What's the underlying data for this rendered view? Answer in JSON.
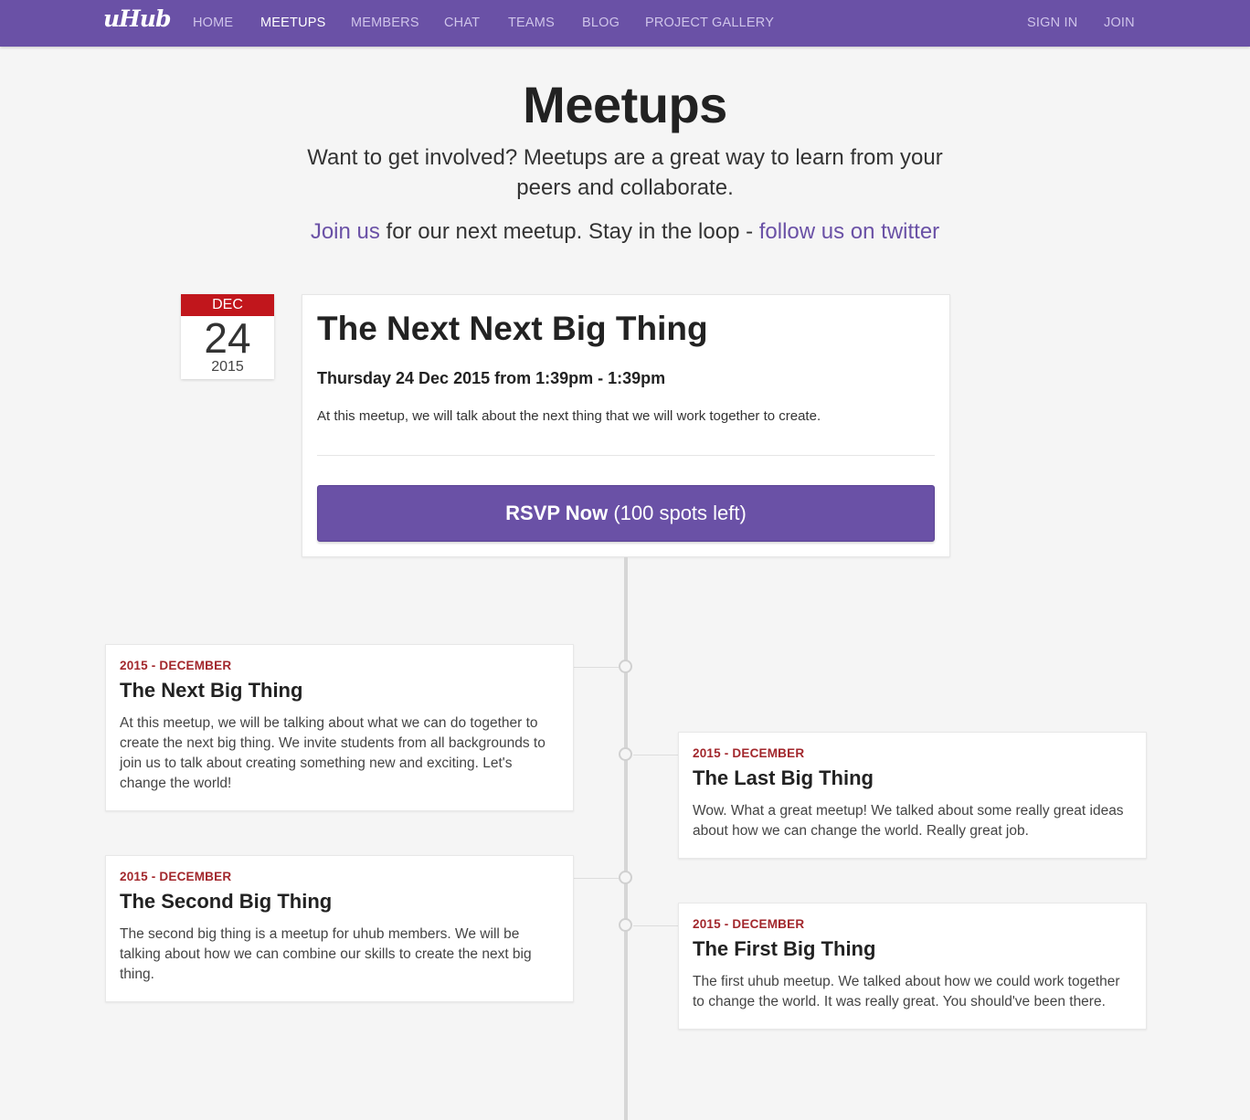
{
  "nav": {
    "brand": "uHub",
    "links": [
      "HOME",
      "MEETUPS",
      "MEMBERS",
      "CHAT",
      "TEAMS",
      "BLOG",
      "PROJECT GALLERY"
    ],
    "right": [
      "SIGN IN",
      "JOIN"
    ],
    "active": "MEETUPS"
  },
  "header": {
    "title": "Meetups",
    "lead": "Want to get involved? Meetups are a great way to learn from your peers and collaborate.",
    "cta_join": "Join us",
    "cta_middle": " for our next meetup. Stay in the loop - ",
    "cta_twitter": "follow us on twitter"
  },
  "featured": {
    "month": "DEC",
    "day": "24",
    "year": "2015",
    "title": "The Next Next Big Thing",
    "when": "Thursday 24 Dec 2015 from 1:39pm - 1:39pm",
    "description": "At this meetup, we will talk about the next thing that we will work together to create.",
    "rsvp_strong": "RSVP Now",
    "rsvp_rest": " (100 spots left)"
  },
  "timeline": [
    {
      "date": "2015 - DECEMBER",
      "title": "The Next Big Thing",
      "description": "At this meetup, we will be talking about what we can do together to create the next big thing. We invite students from all backgrounds to join us to talk about creating something new and exciting. Let's change the world!"
    },
    {
      "date": "2015 - DECEMBER",
      "title": "The Last Big Thing",
      "description": "Wow. What a great meetup! We talked about some really great ideas about how we can change the world. Really great job."
    },
    {
      "date": "2015 - DECEMBER",
      "title": "The Second Big Thing",
      "description": "The second big thing is a meetup for uhub members. We will be talking about how we can combine our skills to create the next big thing."
    },
    {
      "date": "2015 - DECEMBER",
      "title": "The First Big Thing",
      "description": "The first uhub meetup. We talked about how we could work together to change the world. It was really great. You should've been there."
    }
  ],
  "colors": {
    "brand": "#6a51a6",
    "date_badge": "#c1161c",
    "timeline_date": "#a2272c"
  }
}
